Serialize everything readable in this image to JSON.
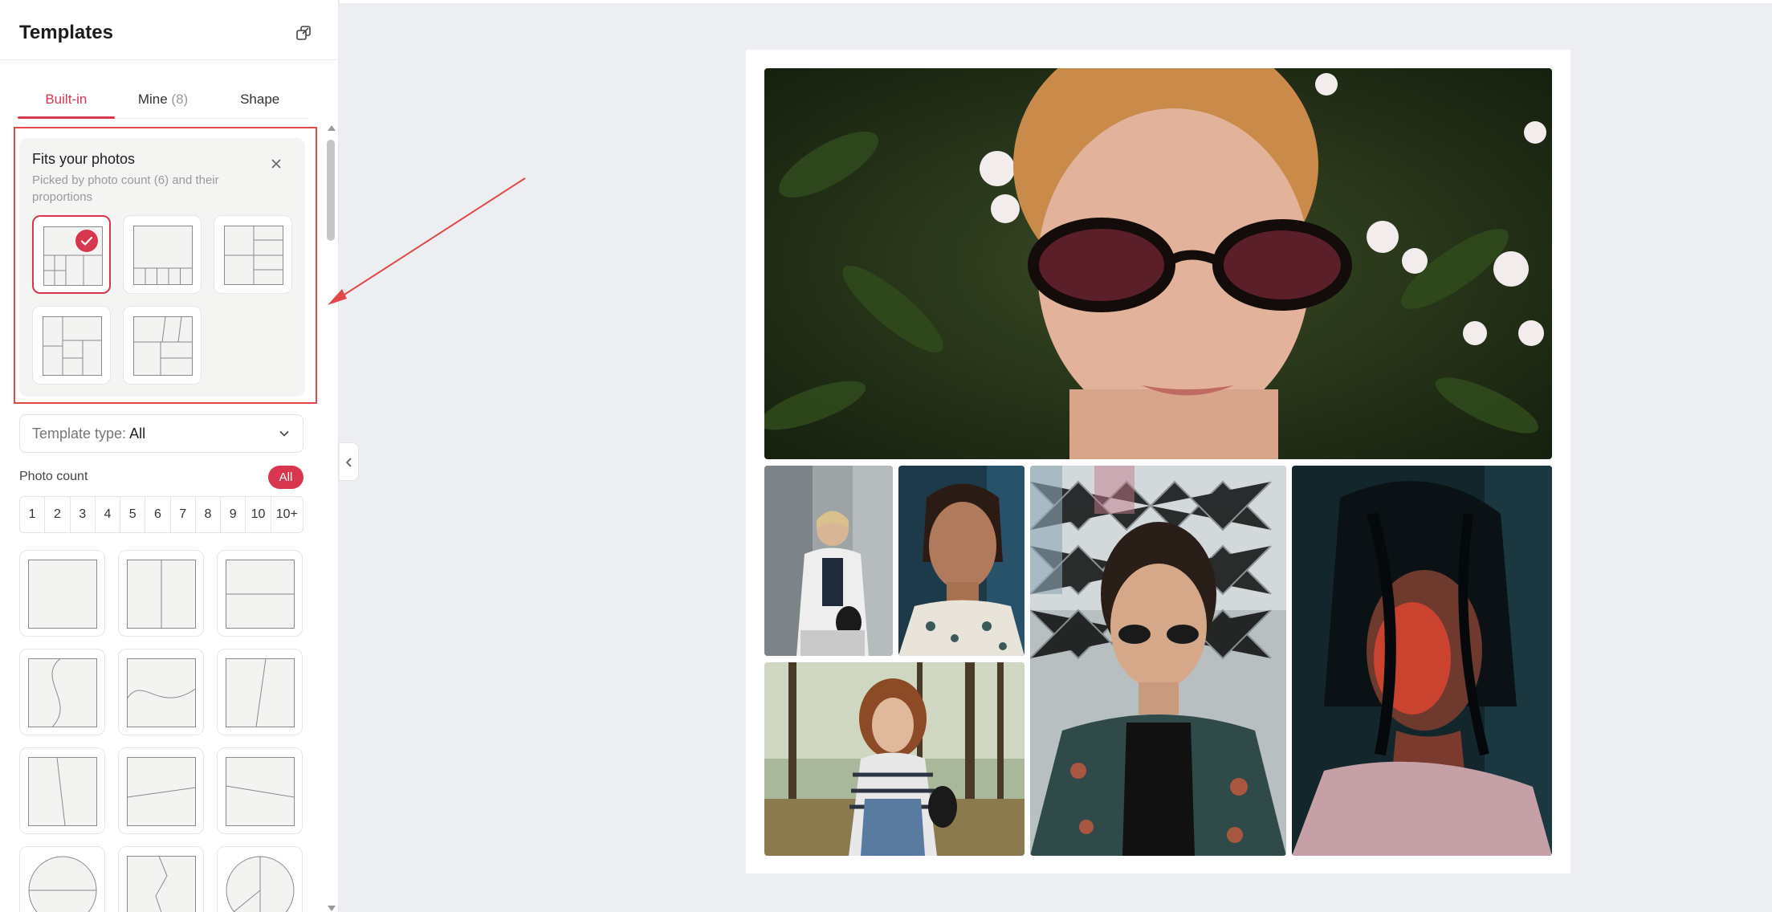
{
  "sidebar": {
    "title": "Templates",
    "tabs": [
      {
        "label": "Built-in",
        "count": ""
      },
      {
        "label": "Mine",
        "count": "(8)"
      },
      {
        "label": "Shape",
        "count": ""
      }
    ],
    "fits": {
      "title": "Fits your photos",
      "subtitle": "Picked by photo count (6) and their proportions"
    },
    "template_type": {
      "label": "Template type:",
      "value": "All"
    },
    "photo_count": {
      "label": "Photo count",
      "all_label": "All",
      "options": [
        "1",
        "2",
        "3",
        "4",
        "5",
        "6",
        "7",
        "8",
        "9",
        "10",
        "10+"
      ]
    }
  },
  "icons": {
    "detach": "detach-window-icon",
    "close": "close-icon",
    "check": "check-icon",
    "chevron": "chevron-down-icon",
    "collapse": "chevron-left-icon"
  },
  "colors": {
    "accent": "#d7364e",
    "highlight": "#e24848",
    "canvas_bg": "#edeef2"
  }
}
